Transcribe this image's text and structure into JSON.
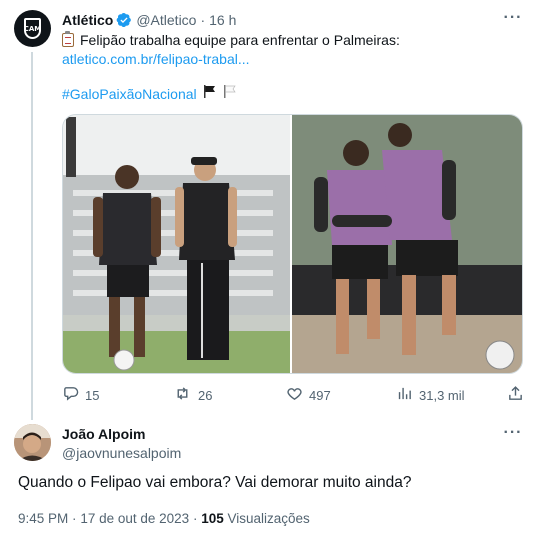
{
  "tweet": {
    "author_name": "Atlético",
    "handle": "@Atletico",
    "separator": "·",
    "time": "16 h",
    "text": "Felipão trabalha equipe para enfrentar o Palmeiras:",
    "link": "atletico.com.br/felipao-trabal...",
    "hashtag": "#GaloPaixãoNacional",
    "avatar_text": "CAM",
    "photos": [
      {
        "name": "photo-hulk-felipao",
        "scene": "training-field-two-people"
      },
      {
        "name": "photo-players-ball",
        "scene": "two-players-with-ball"
      }
    ],
    "actions": {
      "replies": "15",
      "retweets": "26",
      "likes": "497",
      "views": "31,3 mil"
    }
  },
  "reply": {
    "author_name": "João Alpoim",
    "handle": "@jaovnunesalpoim",
    "text": "Quando o Felipao vai embora? Vai demorar muito ainda?",
    "time": "9:45 PM",
    "date": "17 de out de 2023",
    "views_count": "105",
    "views_label": "Visualizações",
    "separator": "·"
  },
  "colors": {
    "link": "#1d9bf0",
    "verified": "#1d9bf0",
    "muted": "#536471",
    "text": "#0f1419",
    "thread_line": "#cfd9de"
  },
  "icons": [
    "verified-badge-icon",
    "clipboard-emoji-icon",
    "black-flag-icon",
    "white-flag-icon",
    "more-icon",
    "reply-icon",
    "retweet-icon",
    "like-icon",
    "views-icon",
    "share-icon"
  ]
}
